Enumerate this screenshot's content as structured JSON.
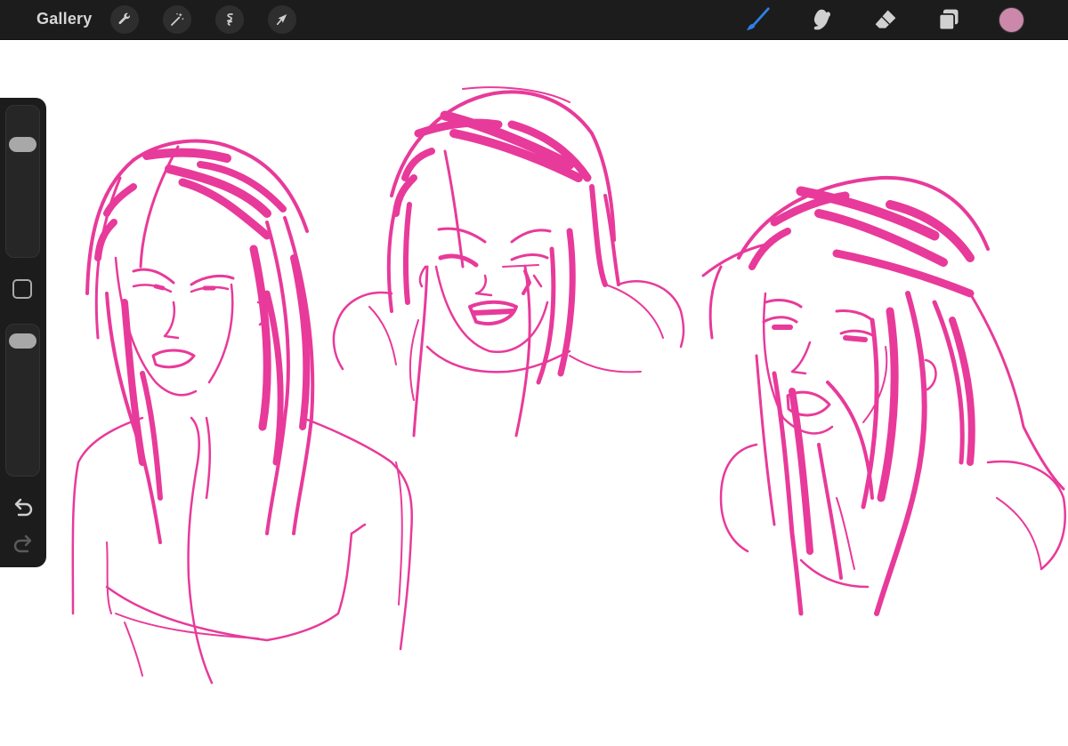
{
  "topbar": {
    "gallery_label": "Gallery",
    "left_tools": [
      "wrench-icon",
      "magic-wand-icon",
      "selection-icon",
      "transform-arrow-icon"
    ],
    "right_tools": [
      "brush-icon",
      "smudge-icon",
      "eraser-icon",
      "layers-icon"
    ],
    "active_tool": "brush-icon",
    "current_color": "#cc88aa"
  },
  "sidebar": {
    "brush_size_level": 0.22,
    "opacity_level": 0.05,
    "controls": [
      "modify-square-button",
      "undo-icon",
      "redo-icon"
    ]
  },
  "canvas": {
    "background": "#ffffff",
    "ink_color": "#e83a9a",
    "sketches": [
      "sketch-figure-left",
      "sketch-figure-center",
      "sketch-figure-right"
    ]
  },
  "colors": {
    "ui_dark": "#1c1c1c",
    "active_blue": "#2f7fe6",
    "icon_gray": "#cfcfcf"
  }
}
